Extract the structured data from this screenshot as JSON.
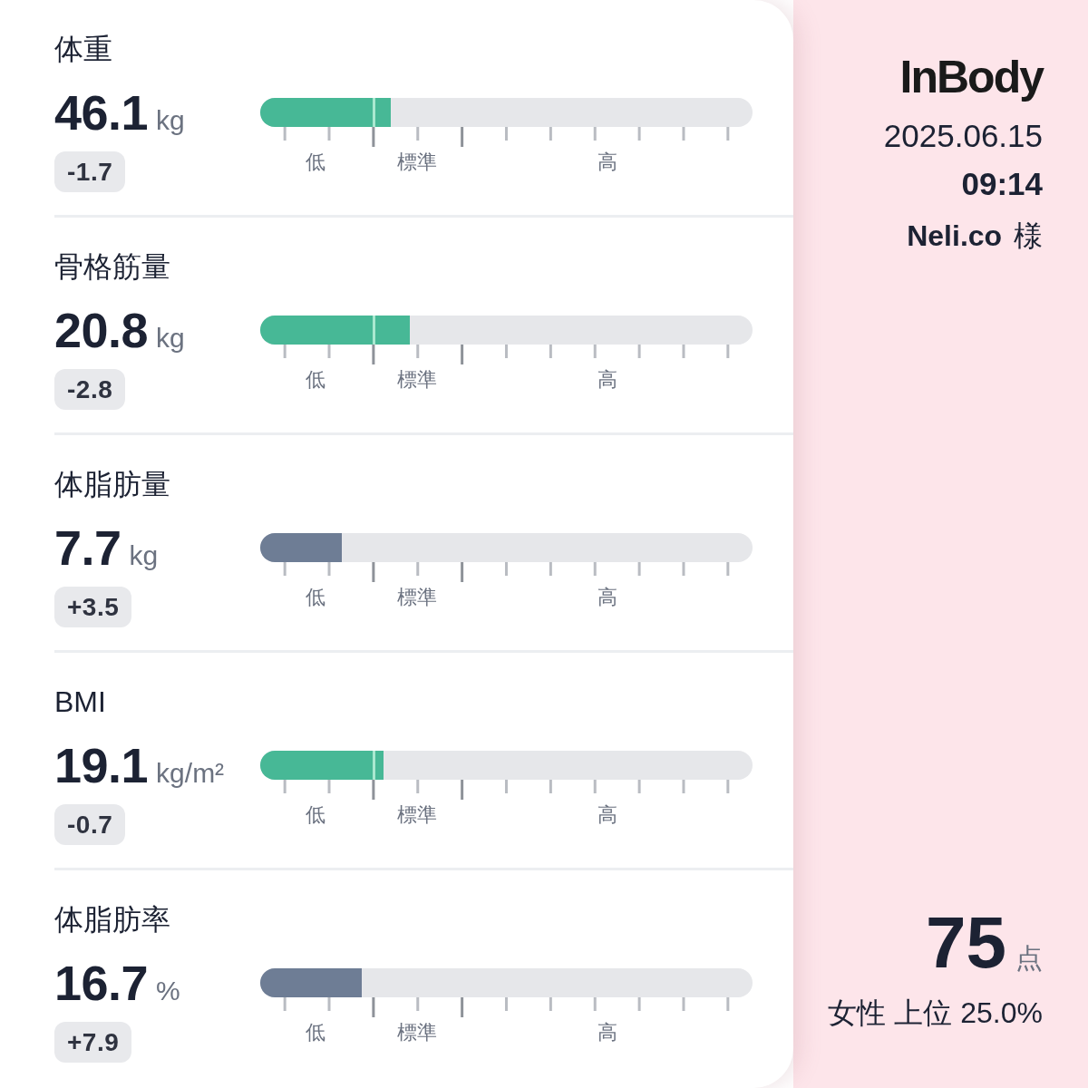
{
  "metrics": [
    {
      "label": "体重",
      "value": "46.1",
      "unit": "kg",
      "change": "-1.7",
      "level": 0.265,
      "color": "#47b896",
      "scale_labels": [
        "低",
        "標準",
        "高"
      ]
    },
    {
      "label": "骨格筋量",
      "value": "20.8",
      "unit": "kg",
      "change": "-2.8",
      "level": 0.304,
      "color": "#47b896",
      "scale_labels": [
        "低",
        "標準",
        "高"
      ]
    },
    {
      "label": "体脂肪量",
      "value": "7.7",
      "unit": "kg",
      "change": "+3.5",
      "level": 0.166,
      "color": "#6e7d95",
      "scale_labels": [
        "低",
        "標準",
        "高"
      ]
    },
    {
      "label": "BMI",
      "value": "19.1",
      "unit": "kg/m²",
      "change": "-0.7",
      "level": 0.25,
      "color": "#47b896",
      "scale_labels": [
        "低",
        "標準",
        "高"
      ]
    },
    {
      "label": "体脂肪率",
      "value": "16.7",
      "unit": "%",
      "change": "+7.9",
      "level": 0.206,
      "color": "#6e7d95",
      "scale_labels": [
        "低",
        "標準",
        "高"
      ]
    }
  ],
  "brand": {
    "logo": "InBody"
  },
  "measurement": {
    "date": "2025.06.15",
    "time": "09:14",
    "user": "**Neli.co** 様"
  },
  "score": {
    "value": "75",
    "unit": "点",
    "ranking": "女性 上位 25.0%"
  }
}
